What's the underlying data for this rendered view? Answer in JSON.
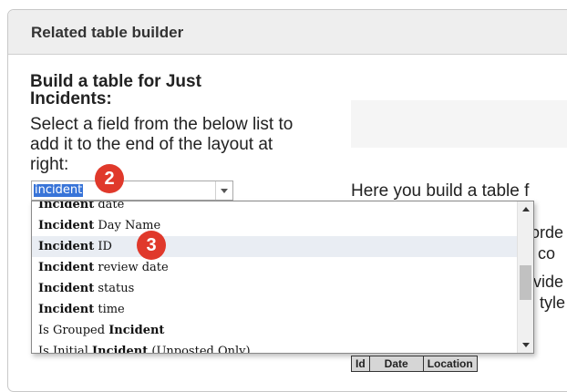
{
  "header": {
    "title": "Related table builder"
  },
  "left": {
    "build_title": "Build a table for Just Incidents:",
    "instructions": "Select a field from the below list to add it to the end of the layout at right:"
  },
  "combo": {
    "value": "incident"
  },
  "dropdown": {
    "items": [
      {
        "pre": "",
        "bold": "Incident",
        "post": " date"
      },
      {
        "pre": "",
        "bold": "Incident",
        "post": " Day Name"
      },
      {
        "pre": "",
        "bold": "Incident",
        "post": " ID"
      },
      {
        "pre": "",
        "bold": "Incident",
        "post": " review date"
      },
      {
        "pre": "",
        "bold": "Incident",
        "post": " status"
      },
      {
        "pre": "",
        "bold": "Incident",
        "post": " time"
      },
      {
        "pre": "Is Grouped ",
        "bold": "Incident",
        "post": ""
      },
      {
        "pre": "Is Initial ",
        "bold": "Incident",
        "post": " (Unposted Only)"
      }
    ],
    "highlighted_index": 2
  },
  "right": {
    "here_text": "Here you build a table f",
    "fragments": [
      "orde",
      "co",
      "vide",
      "tyle"
    ]
  },
  "badges": [
    "2",
    "3"
  ],
  "mini_table": {
    "columns": [
      "Id",
      "Date",
      "Location"
    ]
  }
}
